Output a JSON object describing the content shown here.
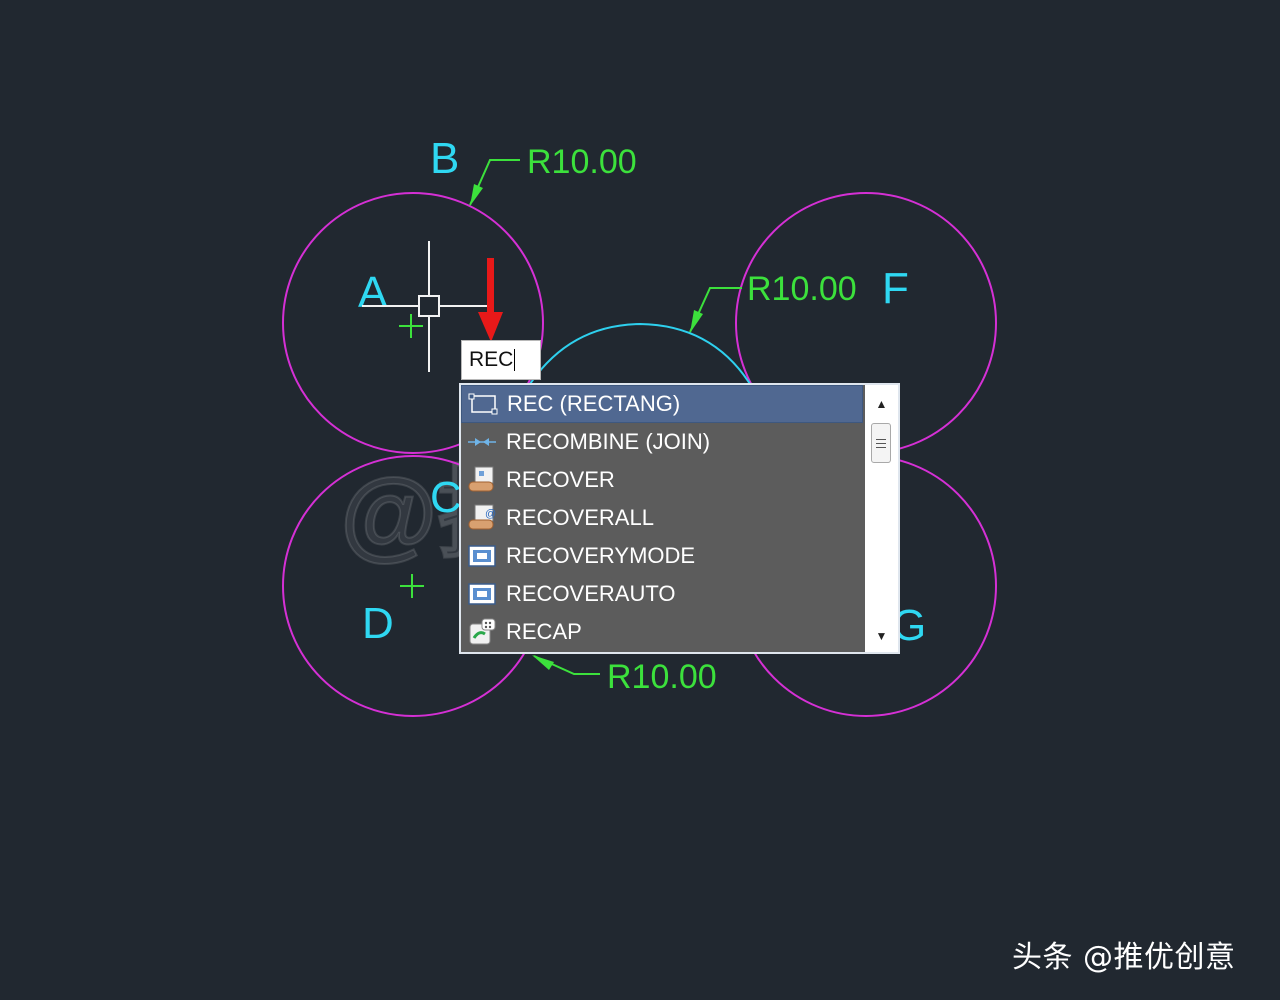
{
  "drawing": {
    "point_labels": [
      "A",
      "B",
      "C",
      "D",
      "F",
      "G"
    ],
    "dimension_labels": [
      "R10.00",
      "R10.00",
      "R10.00"
    ],
    "colors": {
      "background": "#212830",
      "circle": "#d530d5",
      "arc": "#2ed0ee",
      "dimension": "#3ce13c",
      "point_label": "#2fd8f2",
      "arrow": "#e81919",
      "crosshair": "#f2f2f2"
    }
  },
  "command_line": {
    "input_value": "REC"
  },
  "autocomplete": {
    "items": [
      {
        "label": "REC (RECTANG)",
        "icon": "rectangle-icon",
        "selected": true
      },
      {
        "label": "RECOMBINE (JOIN)",
        "icon": "join-icon",
        "selected": false
      },
      {
        "label": "RECOVER",
        "icon": "recover-icon",
        "selected": false
      },
      {
        "label": "RECOVERALL",
        "icon": "recoverall-icon",
        "selected": false
      },
      {
        "label": "RECOVERYMODE",
        "icon": "recoverymode-icon",
        "selected": false
      },
      {
        "label": "RECOVERAUTO",
        "icon": "recoverauto-icon",
        "selected": false
      },
      {
        "label": "RECAP",
        "icon": "recap-icon",
        "selected": false
      }
    ],
    "scroll_up_icon": "scroll-up-arrow-icon",
    "scroll_down_icon": "scroll-down-arrow-icon"
  },
  "watermark": {
    "text": "头条 @推优创意",
    "overlay_text": "@推优创意"
  }
}
